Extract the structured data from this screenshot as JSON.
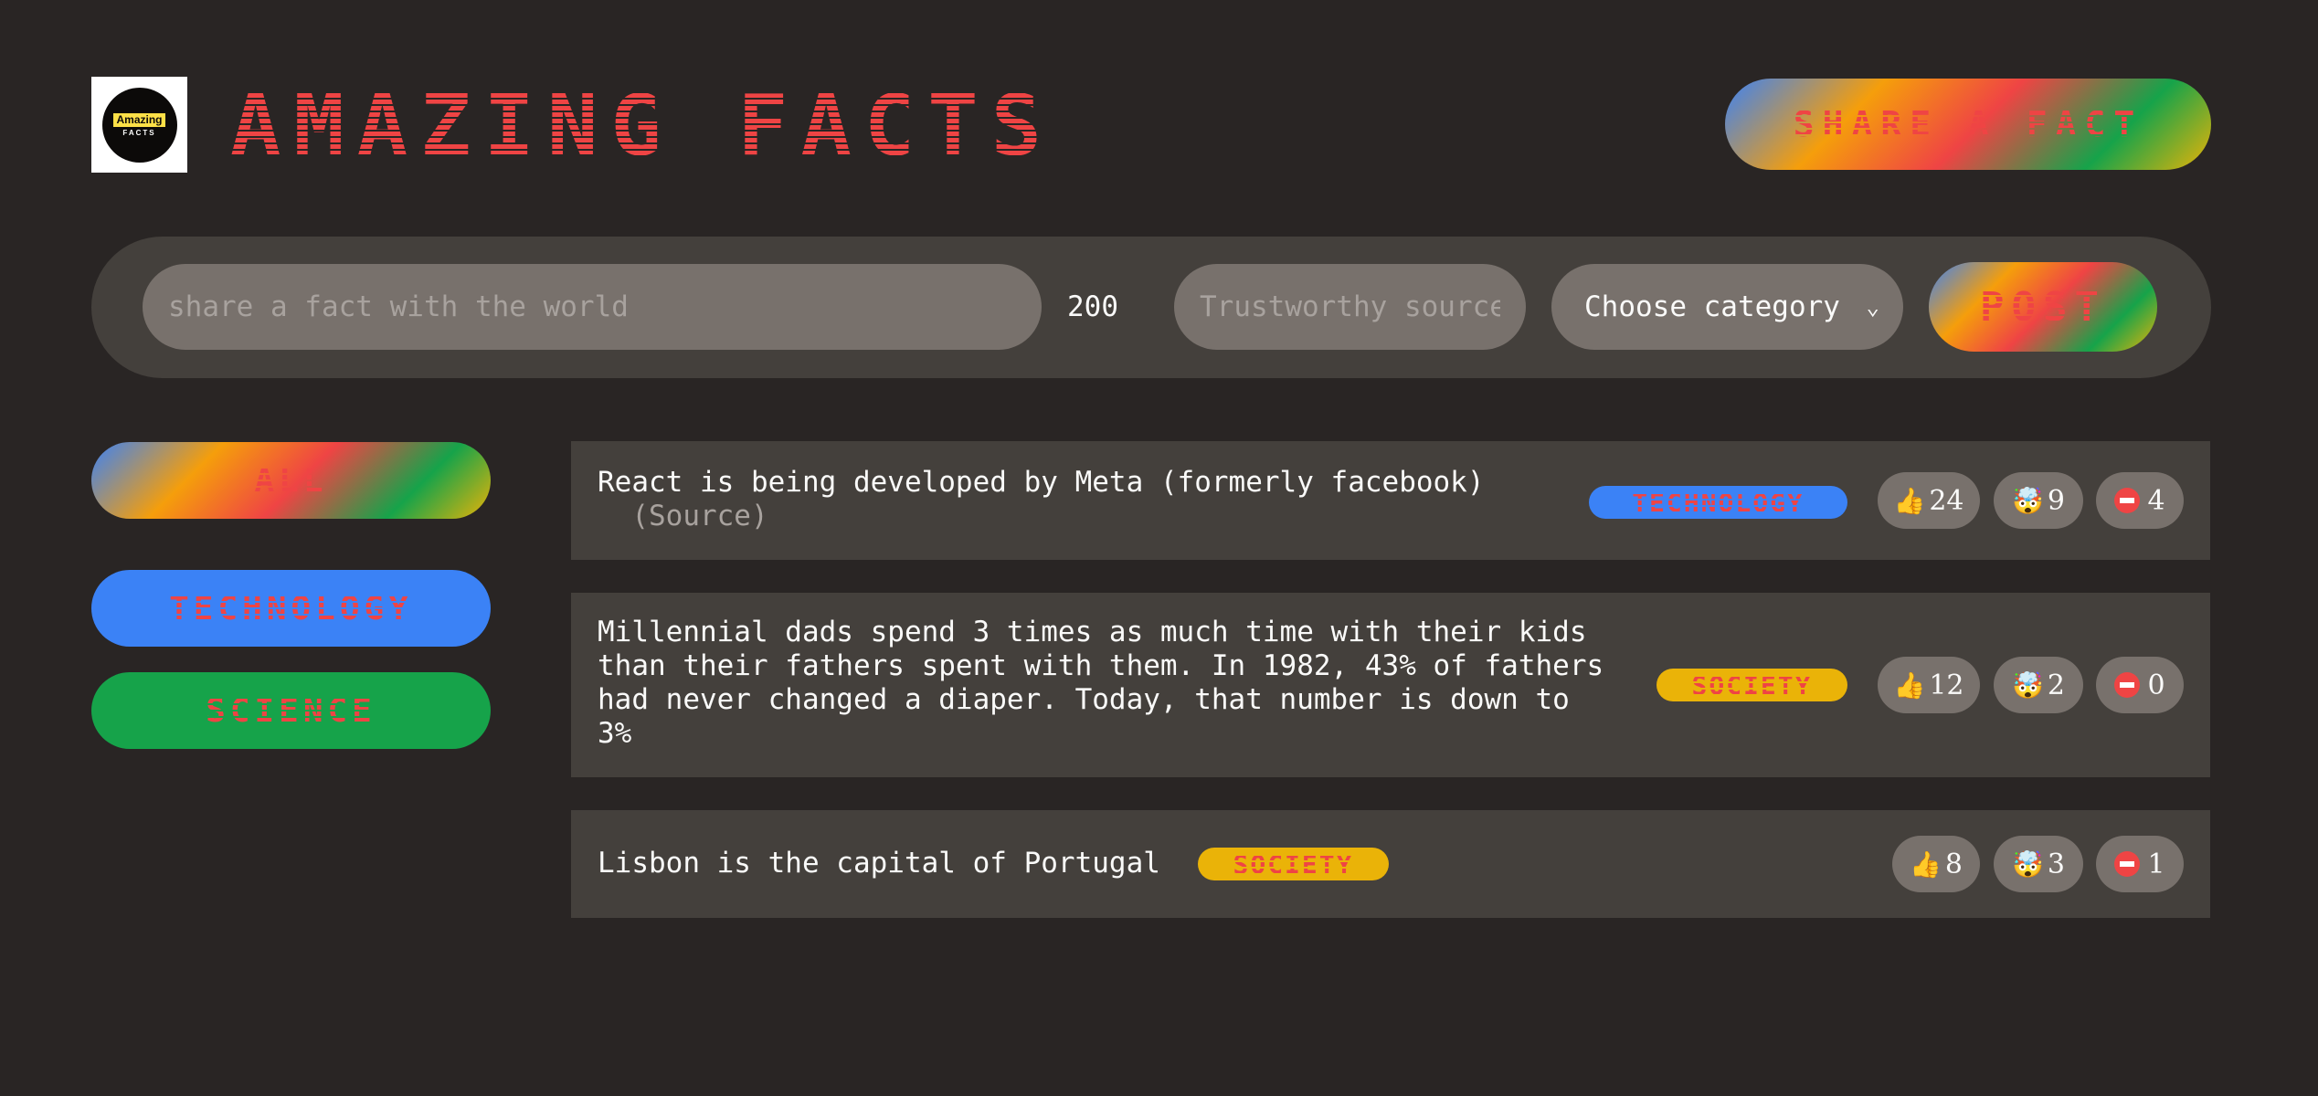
{
  "header": {
    "logo_top": "Amazing",
    "logo_bottom": "FACTS",
    "title": "AMAZING FACTS",
    "share_button": "SHARE A FACT"
  },
  "form": {
    "fact_placeholder": "share a fact with the world",
    "char_count": "200",
    "source_placeholder": "Trustworthy source",
    "category_value": "Choose category",
    "post_button": "POST"
  },
  "sidebar": {
    "items": [
      {
        "label": "ALL",
        "color": "gradient"
      },
      {
        "label": "TECHNOLOGY",
        "color": "#3b82f6"
      },
      {
        "label": "SCIENCE",
        "color": "#16a34a"
      }
    ]
  },
  "facts": [
    {
      "text": "React is being developed by Meta (formerly facebook)",
      "source_label": "(Source)",
      "category": "TECHNOLOGY",
      "category_color": "#3b82f6",
      "votes": {
        "interesting": "24",
        "mindblowing": "9",
        "false": "4"
      }
    },
    {
      "text_lines": [
        "Millennial dads spend 3 times as much time with their kids",
        "than their fathers spent with them. In 1982, 43% of fathers",
        "had never changed a diaper. Today, that number is down to",
        "3%"
      ],
      "category": "SOCIETY",
      "category_color": "#eab308",
      "votes": {
        "interesting": "12",
        "mindblowing": "2",
        "false": "0"
      }
    },
    {
      "text": "Lisbon is the capital of Portugal",
      "category": "SOCIETY",
      "category_color": "#eab308",
      "votes": {
        "interesting": "8",
        "mindblowing": "3",
        "false": "1"
      }
    }
  ],
  "icons": {
    "like": "thumbs-up-icon",
    "mindblowing": "exploding-head-icon",
    "false": "no-entry-icon"
  },
  "colors": {
    "background": "#292524",
    "panel": "#44403c",
    "input": "#78716c",
    "accent_red": "#ef4444",
    "technology": "#3b82f6",
    "science": "#16a34a",
    "society": "#eab308"
  }
}
